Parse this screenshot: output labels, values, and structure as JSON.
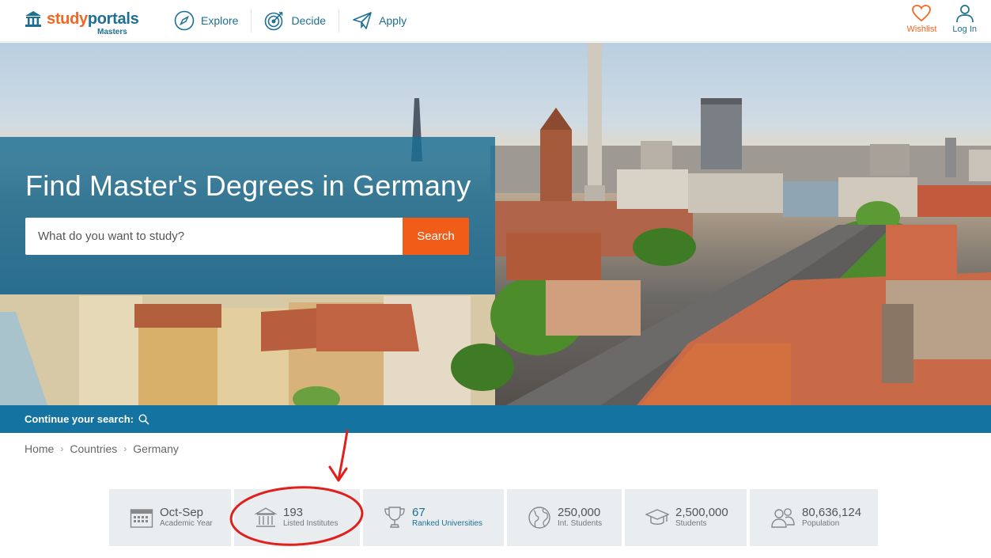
{
  "brand": {
    "name_part1": "study",
    "name_part2": "portals",
    "sub": "Masters",
    "color_orange": "#f16722",
    "color_blue": "#1d6f94"
  },
  "nav": {
    "items": [
      {
        "label": "Explore",
        "icon": "compass-icon"
      },
      {
        "label": "Decide",
        "icon": "target-icon"
      },
      {
        "label": "Apply",
        "icon": "paper-plane-icon"
      }
    ]
  },
  "header_right": {
    "wishlist_label": "Wishlist",
    "login_label": "Log In"
  },
  "hero": {
    "title": "Find Master's Degrees in Germany",
    "search_placeholder": "What do you want to study?",
    "search_button": "Search"
  },
  "continue_bar": {
    "label": "Continue your search:"
  },
  "breadcrumb": [
    "Home",
    "Countries",
    "Germany"
  ],
  "stats": [
    {
      "value": "Oct-Sep",
      "caption": "Academic Year",
      "icon": "calendar-icon"
    },
    {
      "value": "193",
      "caption": "Listed Institutes",
      "icon": "institution-icon"
    },
    {
      "value": "67",
      "caption": "Ranked Universities",
      "icon": "trophy-icon"
    },
    {
      "value": "250,000",
      "caption": "Int. Students",
      "icon": "globe-icon"
    },
    {
      "value": "2,500,000",
      "caption": "Students",
      "icon": "graduation-cap-icon"
    },
    {
      "value": "80,636,124",
      "caption": "Population",
      "icon": "people-icon"
    }
  ],
  "accent_colors": {
    "search_button": "#f25c19",
    "continue_bar": "#1573a1",
    "annotation_red": "#e0201c"
  }
}
